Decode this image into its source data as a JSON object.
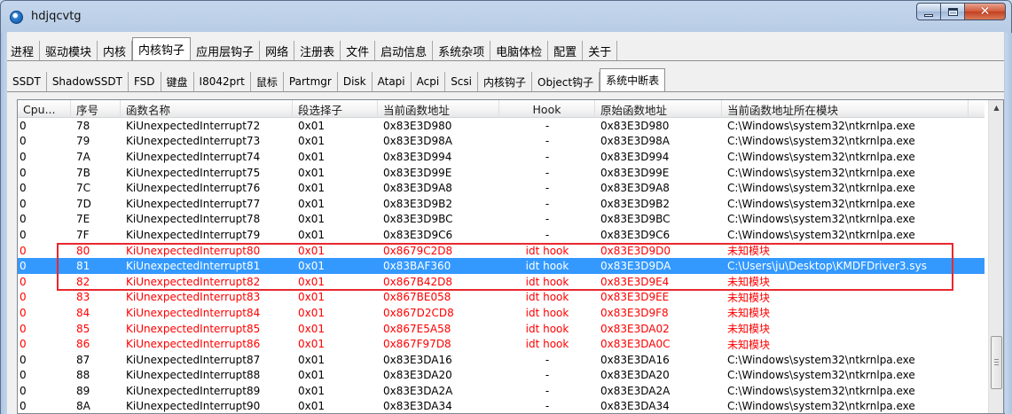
{
  "window": {
    "title": "hdjqcvtg"
  },
  "main_tabs": [
    "进程",
    "驱动模块",
    "内核",
    "内核钩子",
    "应用层钩子",
    "网络",
    "注册表",
    "文件",
    "启动信息",
    "系统杂项",
    "电脑体检",
    "配置",
    "关于"
  ],
  "main_tab_active": "内核钩子",
  "sub_tabs": [
    "SSDT",
    "ShadowSSDT",
    "FSD",
    "键盘",
    "I8042prt",
    "鼠标",
    "Partmgr",
    "Disk",
    "Atapi",
    "Acpi",
    "Scsi",
    "内核钩子",
    "Object钩子",
    "系统中断表"
  ],
  "sub_tab_active": "系统中断表",
  "columns": [
    "Cpu...",
    "序号",
    "函数名称",
    "段选择子",
    "当前函数地址",
    "Hook",
    "原始函数地址",
    "当前函数地址所在模块"
  ],
  "rows": [
    {
      "cpu": "0",
      "idx": "78",
      "name": "KiUnexpectedInterrupt72",
      "sel": "0x01",
      "cur": "0x83E3D980",
      "hook": "-",
      "orig": "0x83E3D980",
      "module": "C:\\Windows\\system32\\ntkrnlpa.exe",
      "state": "normal"
    },
    {
      "cpu": "0",
      "idx": "79",
      "name": "KiUnexpectedInterrupt73",
      "sel": "0x01",
      "cur": "0x83E3D98A",
      "hook": "-",
      "orig": "0x83E3D98A",
      "module": "C:\\Windows\\system32\\ntkrnlpa.exe",
      "state": "normal"
    },
    {
      "cpu": "0",
      "idx": "7A",
      "name": "KiUnexpectedInterrupt74",
      "sel": "0x01",
      "cur": "0x83E3D994",
      "hook": "-",
      "orig": "0x83E3D994",
      "module": "C:\\Windows\\system32\\ntkrnlpa.exe",
      "state": "normal"
    },
    {
      "cpu": "0",
      "idx": "7B",
      "name": "KiUnexpectedInterrupt75",
      "sel": "0x01",
      "cur": "0x83E3D99E",
      "hook": "-",
      "orig": "0x83E3D99E",
      "module": "C:\\Windows\\system32\\ntkrnlpa.exe",
      "state": "normal"
    },
    {
      "cpu": "0",
      "idx": "7C",
      "name": "KiUnexpectedInterrupt76",
      "sel": "0x01",
      "cur": "0x83E3D9A8",
      "hook": "-",
      "orig": "0x83E3D9A8",
      "module": "C:\\Windows\\system32\\ntkrnlpa.exe",
      "state": "normal"
    },
    {
      "cpu": "0",
      "idx": "7D",
      "name": "KiUnexpectedInterrupt77",
      "sel": "0x01",
      "cur": "0x83E3D9B2",
      "hook": "-",
      "orig": "0x83E3D9B2",
      "module": "C:\\Windows\\system32\\ntkrnlpa.exe",
      "state": "normal"
    },
    {
      "cpu": "0",
      "idx": "7E",
      "name": "KiUnexpectedInterrupt78",
      "sel": "0x01",
      "cur": "0x83E3D9BC",
      "hook": "-",
      "orig": "0x83E3D9BC",
      "module": "C:\\Windows\\system32\\ntkrnlpa.exe",
      "state": "normal"
    },
    {
      "cpu": "0",
      "idx": "7F",
      "name": "KiUnexpectedInterrupt79",
      "sel": "0x01",
      "cur": "0x83E3D9C6",
      "hook": "-",
      "orig": "0x83E3D9C6",
      "module": "C:\\Windows\\system32\\ntkrnlpa.exe",
      "state": "normal"
    },
    {
      "cpu": "0",
      "idx": "80",
      "name": "KiUnexpectedInterrupt80",
      "sel": "0x01",
      "cur": "0x8679C2D8",
      "hook": "idt hook",
      "orig": "0x83E3D9D0",
      "module": "未知模块",
      "state": "hooked"
    },
    {
      "cpu": "0",
      "idx": "81",
      "name": "KiUnexpectedInterrupt81",
      "sel": "0x01",
      "cur": "0x83BAF360",
      "hook": "idt hook",
      "orig": "0x83E3D9DA",
      "module": "C:\\Users\\ju\\Desktop\\KMDFDriver3.sys",
      "state": "selected"
    },
    {
      "cpu": "0",
      "idx": "82",
      "name": "KiUnexpectedInterrupt82",
      "sel": "0x01",
      "cur": "0x867B42D8",
      "hook": "idt hook",
      "orig": "0x83E3D9E4",
      "module": "未知模块",
      "state": "hooked"
    },
    {
      "cpu": "0",
      "idx": "83",
      "name": "KiUnexpectedInterrupt83",
      "sel": "0x01",
      "cur": "0x867BE058",
      "hook": "idt hook",
      "orig": "0x83E3D9EE",
      "module": "未知模块",
      "state": "hooked"
    },
    {
      "cpu": "0",
      "idx": "84",
      "name": "KiUnexpectedInterrupt84",
      "sel": "0x01",
      "cur": "0x867D2CD8",
      "hook": "idt hook",
      "orig": "0x83E3D9F8",
      "module": "未知模块",
      "state": "hooked"
    },
    {
      "cpu": "0",
      "idx": "85",
      "name": "KiUnexpectedInterrupt85",
      "sel": "0x01",
      "cur": "0x867E5A58",
      "hook": "idt hook",
      "orig": "0x83E3DA02",
      "module": "未知模块",
      "state": "hooked"
    },
    {
      "cpu": "0",
      "idx": "86",
      "name": "KiUnexpectedInterrupt86",
      "sel": "0x01",
      "cur": "0x867F97D8",
      "hook": "idt hook",
      "orig": "0x83E3DA0C",
      "module": "未知模块",
      "state": "hooked"
    },
    {
      "cpu": "0",
      "idx": "87",
      "name": "KiUnexpectedInterrupt87",
      "sel": "0x01",
      "cur": "0x83E3DA16",
      "hook": "-",
      "orig": "0x83E3DA16",
      "module": "C:\\Windows\\system32\\ntkrnlpa.exe",
      "state": "normal"
    },
    {
      "cpu": "0",
      "idx": "88",
      "name": "KiUnexpectedInterrupt88",
      "sel": "0x01",
      "cur": "0x83E3DA20",
      "hook": "-",
      "orig": "0x83E3DA20",
      "module": "C:\\Windows\\system32\\ntkrnlpa.exe",
      "state": "normal"
    },
    {
      "cpu": "0",
      "idx": "89",
      "name": "KiUnexpectedInterrupt89",
      "sel": "0x01",
      "cur": "0x83E3DA2A",
      "hook": "-",
      "orig": "0x83E3DA2A",
      "module": "C:\\Windows\\system32\\ntkrnlpa.exe",
      "state": "normal"
    },
    {
      "cpu": "0",
      "idx": "8A",
      "name": "KiUnexpectedInterrupt90",
      "sel": "0x01",
      "cur": "0x83E3DA34",
      "hook": "-",
      "orig": "0x83E3DA34",
      "module": "C:\\Windows\\system32\\ntkrnlpa.exe",
      "state": "normal"
    }
  ],
  "colors": {
    "hooked_text": "#ff0000",
    "selection": "#3399ff",
    "highlight_box": "#e8282d"
  },
  "icons": {
    "app": "app-globe-icon",
    "minimize": "minimize-icon",
    "maximize": "maximize-icon",
    "close": "close-icon",
    "scroll_up": "scroll-up-arrow-icon"
  }
}
